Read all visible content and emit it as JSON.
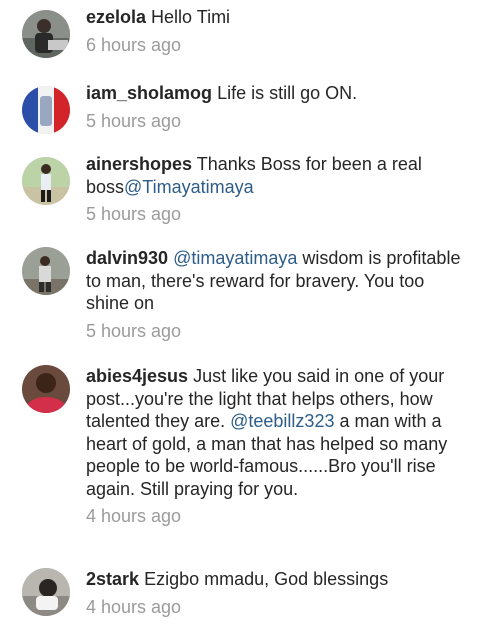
{
  "comments": [
    {
      "username": "ezelola",
      "text": "Hello Timi",
      "time": "6 hours ago"
    },
    {
      "username": "iam_sholamog",
      "text": "Life is still go ON.",
      "time": "5 hours ago"
    },
    {
      "username": "ainershopes",
      "text": "Thanks Boss for been a real boss",
      "mention": "@Timayatimaya",
      "time": "5 hours ago"
    },
    {
      "username": "dalvin930",
      "mention": "@timayatimaya",
      "text": "wisdom is profitable to man, there's reward for bravery. You too shine on",
      "time": "5 hours ago"
    },
    {
      "username": "abies4jesus",
      "text": "Just like you said in one of your post...you're the light that helps others, how talented they are.",
      "mention": "@teebillz323",
      "text2": "a man with a heart of gold, a man that has helped so many people to be world-famous......Bro you'll rise again. Still praying for you.",
      "time": "4 hours ago"
    },
    {
      "username": "2stark",
      "text": "Ezigbo mmadu, God blessings",
      "time": "4 hours ago"
    }
  ]
}
